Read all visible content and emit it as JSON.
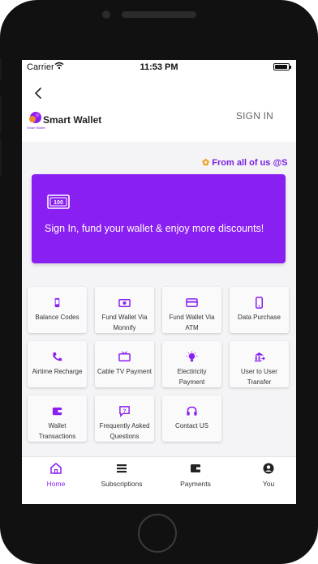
{
  "status_bar": {
    "carrier": "Carrier",
    "time": "11:53 PM"
  },
  "header": {
    "back_icon": "chevron-left-icon",
    "logo_text": "Smart Wallet",
    "logo_sub": "Smart Wallet",
    "sign_in_label": "SIGN IN"
  },
  "marquee": {
    "text": "From all of us @S"
  },
  "banner": {
    "icon": "cash-note-icon",
    "message": "Sign In, fund your wallet & enjoy more discounts!",
    "background_color": "#8a1ff2"
  },
  "services": [
    {
      "label": "Balance Codes",
      "icon": "phone-icon"
    },
    {
      "label": "Fund Wallet Via Monnify",
      "icon": "money-icon"
    },
    {
      "label": "Fund Wallet Via ATM",
      "icon": "card-icon"
    },
    {
      "label": "Data Purchase",
      "icon": "smartphone-icon"
    },
    {
      "label": "Airtime Recharge",
      "icon": "phone-call-icon"
    },
    {
      "label": "Cable TV Payment",
      "icon": "tv-icon"
    },
    {
      "label": "Electiricity Payment",
      "icon": "bulb-icon"
    },
    {
      "label": "User to User Transfer",
      "icon": "transfer-icon"
    },
    {
      "label": "Wallet Transactions",
      "icon": "wallet-icon"
    },
    {
      "label": "Frequently Asked Questions",
      "icon": "help-icon"
    },
    {
      "label": "Contact US",
      "icon": "headset-icon"
    }
  ],
  "tabs": [
    {
      "label": "Home",
      "icon": "home-icon",
      "active": true
    },
    {
      "label": "Subscriptions",
      "icon": "list-icon",
      "active": false
    },
    {
      "label": "Payments",
      "icon": "wallet-icon",
      "active": false
    },
    {
      "label": "You",
      "icon": "user-icon",
      "active": false
    }
  ],
  "colors": {
    "accent": "#8a1ff2",
    "marquee": "#7a1fe0"
  }
}
